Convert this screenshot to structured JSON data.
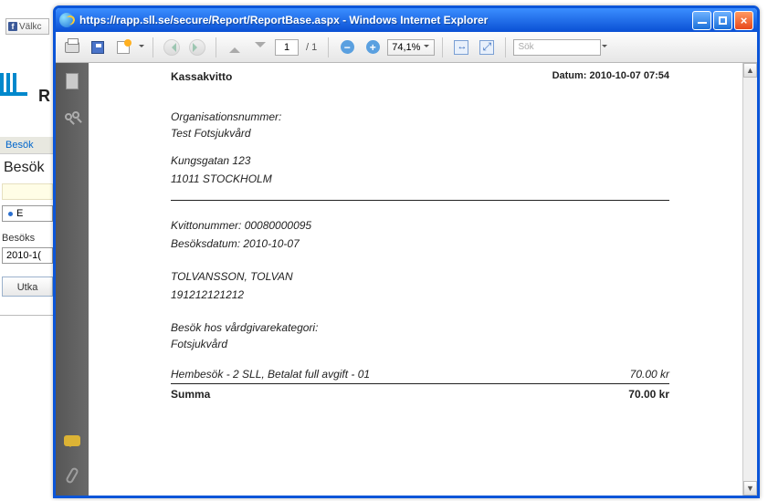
{
  "background": {
    "fb_tab_label": "Välkc",
    "logo_letter": "R",
    "nav_tab1": "Besök",
    "heading": "Besök",
    "list_item": "E",
    "label2": "Besöks",
    "date_value": "2010-1(",
    "button": "Utka"
  },
  "window": {
    "title": "https://rapp.sll.se/secure/Report/ReportBase.aspx - Windows Internet Explorer"
  },
  "toolbar": {
    "page_current": "1",
    "page_total": "/ 1",
    "zoom": "74,1%",
    "search_placeholder": "Sök"
  },
  "report": {
    "header_left": "Kassakvitto",
    "header_right_label": "Datum:",
    "header_right_value": "2010-10-07 07:54",
    "org_label": "Organisationsnummer:",
    "company": "Test Fotsjukvård",
    "address1": "Kungsgatan 123",
    "address2": "11011 STOCKHOLM",
    "receipt_no": "Kvittonummer: 00080000095",
    "visit_date": "Besöksdatum: 2010-10-07",
    "patient_name": "TOLVANSSON, TOLVAN",
    "patient_id": "191212121212",
    "category_label": "Besök hos vårdgivarekategori:",
    "category_value": "Fotsjukvård",
    "line_item_desc": "Hembesök - 2 SLL, Betalat full avgift - 01",
    "line_item_amount": "70.00 kr",
    "sum_label": "Summa",
    "sum_amount": "70.00 kr"
  }
}
